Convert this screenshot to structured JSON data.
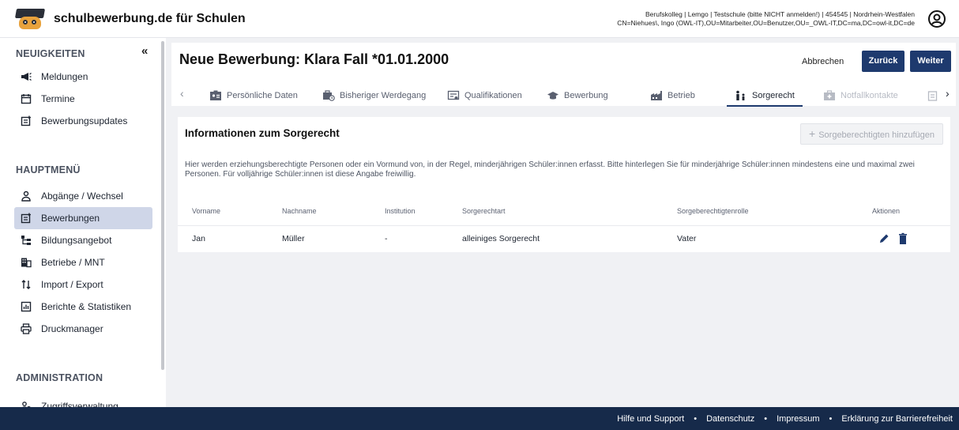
{
  "header": {
    "brand": "schulbewerbung.de für Schulen",
    "info_line1": "Berufskolleg | Lemgo | Testschule (bitte NICHT anmelden!) | 454545 | Nordrhein-Westfalen",
    "info_line2": "CN=Niehues\\, Ingo (OWL-IT),OU=Mitarbeiter,OU=Benutzer,OU=_OWL-IT,DC=ma,DC=owl-it,DC=de"
  },
  "sidebar": {
    "collapse_label": "«",
    "section_news": "NEUIGKEITEN",
    "news_items": [
      {
        "label": "Meldungen",
        "icon": "megaphone-icon"
      },
      {
        "label": "Termine",
        "icon": "calendar-icon"
      },
      {
        "label": "Bewerbungsupdates",
        "icon": "update-icon"
      }
    ],
    "section_main": "HAUPTMENÜ",
    "main_items": [
      {
        "label": "Abgänge / Wechsel",
        "icon": "person-icon"
      },
      {
        "label": "Bewerbungen",
        "icon": "application-icon",
        "active": true
      },
      {
        "label": "Bildungsangebot",
        "icon": "hierarchy-icon"
      },
      {
        "label": "Betriebe / MNT",
        "icon": "building-icon"
      },
      {
        "label": "Import / Export",
        "icon": "import-export-icon"
      },
      {
        "label": "Berichte & Statistiken",
        "icon": "chart-icon"
      },
      {
        "label": "Druckmanager",
        "icon": "printer-icon"
      }
    ],
    "section_admin": "ADMINISTRATION",
    "admin_items": [
      {
        "label": "Zugriffsverwaltung",
        "icon": "users-icon"
      }
    ]
  },
  "page": {
    "title": "Neue Bewerbung: Klara Fall *01.01.2000",
    "cancel_label": "Abbrechen",
    "back_label": "Zurück",
    "next_label": "Weiter",
    "tabs": [
      {
        "label": "Persönliche Daten"
      },
      {
        "label": "Bisheriger Werdegang"
      },
      {
        "label": "Qualifikationen"
      },
      {
        "label": "Bewerbung"
      },
      {
        "label": "Betrieb"
      },
      {
        "label": "Sorgerecht",
        "active": true
      },
      {
        "label": "Notfallkontakte",
        "disabled": true
      }
    ]
  },
  "custody": {
    "title": "Informationen zum Sorgerecht",
    "add_button": "Sorgeberechtigten hinzufügen",
    "description": "Hier werden erziehungsberechtigte Personen oder ein Vormund von, in der Regel, minderjährigen Schüler:innen erfasst. Bitte hinterlegen Sie für minderjährige Schüler:innen mindestens eine und maximal zwei Personen. Für volljährige Schüler:innen ist diese Angabe freiwillig.",
    "columns": [
      "Vorname",
      "Nachname",
      "Institution",
      "Sorgerechtart",
      "Sorgeberechtigtenrolle",
      "Aktionen"
    ],
    "rows": [
      {
        "vorname": "Jan",
        "nachname": "Müller",
        "institution": "-",
        "art": "alleiniges Sorgerecht",
        "rolle": "Vater"
      }
    ]
  },
  "footer": {
    "links": [
      "Hilfe und Support",
      "Datenschutz",
      "Impressum",
      "Erklärung zur Barrierefreiheit"
    ],
    "separator": "•"
  },
  "colors": {
    "primary": "#1e3a6e",
    "footer": "#162a4a",
    "active_nav": "#cfd6e8"
  }
}
